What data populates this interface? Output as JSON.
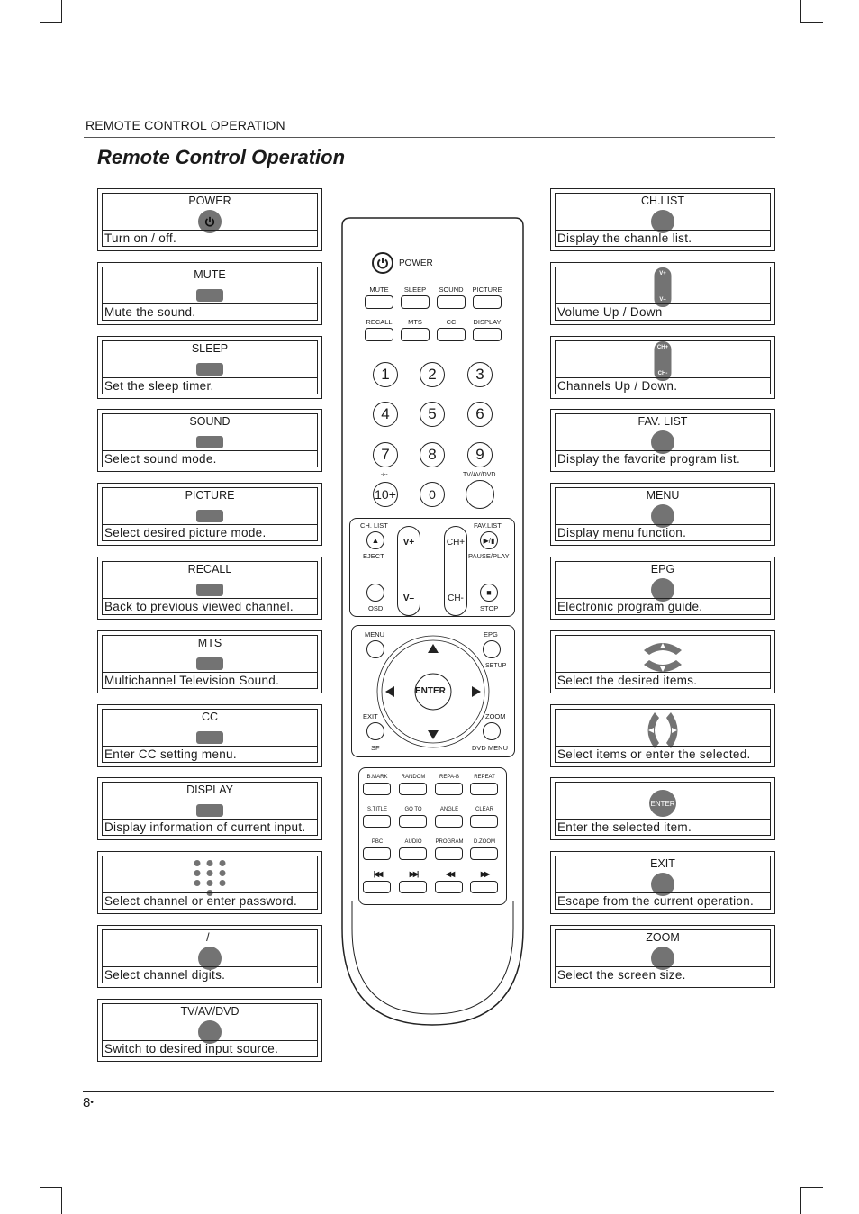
{
  "header": {
    "section_label": "REMOTE CONTROL OPERATION",
    "title": "Remote Control Operation"
  },
  "footer": {
    "page_number": "8",
    "bullet": "•"
  },
  "left_cards": [
    {
      "label": "POWER",
      "icon": "power-button-icon",
      "description": "Turn on / off."
    },
    {
      "label": "MUTE",
      "icon": "rect-button-icon",
      "description": "Mute the sound."
    },
    {
      "label": "SLEEP",
      "icon": "rect-button-icon",
      "description": "Set the sleep timer."
    },
    {
      "label": "SOUND",
      "icon": "rect-button-icon",
      "description": "Select sound mode."
    },
    {
      "label": "PICTURE",
      "icon": "rect-button-icon",
      "description": "Select desired picture mode."
    },
    {
      "label": "RECALL",
      "icon": "rect-button-icon",
      "description": "Back to previous viewed channel."
    },
    {
      "label": "MTS",
      "icon": "rect-button-icon",
      "description": "Multichannel Television Sound."
    },
    {
      "label": "CC",
      "icon": "rect-button-icon",
      "description": "Enter CC setting menu."
    },
    {
      "label": "DISPLAY",
      "icon": "rect-button-icon",
      "description": "Display information of current input."
    },
    {
      "label": "",
      "icon": "number-keypad-icon",
      "description": "Select channel or enter password."
    },
    {
      "label": "-/--",
      "icon": "round-button-icon",
      "description": "Select channel digits."
    },
    {
      "label": "TV/AV/DVD",
      "icon": "round-button-icon",
      "description": "Switch to desired input source."
    }
  ],
  "right_cards": [
    {
      "label": "CH.LIST",
      "icon": "round-button-icon",
      "description": "Display the channle list."
    },
    {
      "label": "",
      "icon": "volume-rocker-icon",
      "icon_text": [
        "V+",
        "V–"
      ],
      "description": "Volume Up / Down"
    },
    {
      "label": "",
      "icon": "channel-rocker-icon",
      "icon_text": [
        "CH+",
        "CH-"
      ],
      "description": "Channels Up / Down."
    },
    {
      "label": "FAV. LIST",
      "icon": "round-button-icon",
      "description": "Display the favorite program list."
    },
    {
      "label": "MENU",
      "icon": "round-button-icon",
      "description": "Display menu function."
    },
    {
      "label": "EPG",
      "icon": "round-button-icon",
      "description": "Electronic program guide."
    },
    {
      "label": "",
      "icon": "up-down-arrows-icon",
      "description": "Select the desired items."
    },
    {
      "label": "",
      "icon": "left-right-arrows-icon",
      "description": "Select items or enter the selected."
    },
    {
      "label": "",
      "icon": "enter-button-icon",
      "icon_text": "ENTER",
      "description": "Enter the selected item."
    },
    {
      "label": "EXIT",
      "icon": "round-button-icon",
      "description": "Escape from the current operation."
    },
    {
      "label": "ZOOM",
      "icon": "round-button-icon",
      "description": "Select the screen size."
    }
  ],
  "remote": {
    "power_label": "POWER",
    "row1": [
      "MUTE",
      "SLEEP",
      "SOUND",
      "PICTURE"
    ],
    "row2": [
      "RECALL",
      "MTS",
      "CC",
      "DISPLAY"
    ],
    "digits": [
      "1",
      "2",
      "3",
      "4",
      "5",
      "6",
      "7",
      "8",
      "9"
    ],
    "dash_label": "-/--",
    "tenplus": "10+",
    "zero": "0",
    "tvavdvd_label": "TV/AV/DVD",
    "chlist_label": "CH. LIST",
    "eject_label": "EJECT",
    "favlist_label": "FAV.LIST",
    "pauseplay_label": "PAUSE/PLAY",
    "osd_label": "OSD",
    "stop_label": "STOP",
    "vplus": "V+",
    "vminus": "V–",
    "chplus": "CH+",
    "chminus": "CH-",
    "menu_label": "MENU",
    "epg_label": "EPG",
    "setup_label": "SETUP",
    "enter_label": "ENTER",
    "exit_label": "EXIT",
    "sf_label": "SF",
    "zoom_label": "ZOOM",
    "dvdmenu_label": "DVD MENU",
    "dvd_row1": [
      "B.MARK",
      "RANDOM",
      "REPA-B",
      "REPEAT"
    ],
    "dvd_row2": [
      "S.TITLE",
      "GO TO",
      "ANGLE",
      "CLEAR"
    ],
    "dvd_row3": [
      "PBC",
      "AUDIO",
      "PROGRAM",
      "D.ZOOM"
    ],
    "transport": [
      "|◀◀",
      "▶▶|",
      "◀◀",
      "▶▶"
    ]
  }
}
